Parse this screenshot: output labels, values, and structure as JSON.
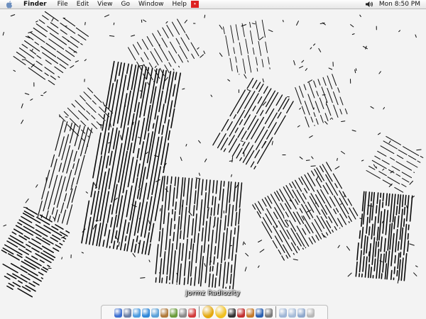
{
  "menubar": {
    "app_name": "Finder",
    "items": [
      "File",
      "Edit",
      "View",
      "Go",
      "Window",
      "Help"
    ],
    "clock": "Mon 8:50 PM"
  },
  "dock": {
    "hover_label": "Jormz Radiozity",
    "icons": [
      {
        "name": "finder-icon",
        "color": "#3d6fd1"
      },
      {
        "name": "mail-icon",
        "color": "#6a7fa6"
      },
      {
        "name": "ichat-icon",
        "color": "#4b9be0"
      },
      {
        "name": "safari-icon",
        "color": "#2f87d8"
      },
      {
        "name": "itunes-icon",
        "color": "#5aa0d8"
      },
      {
        "name": "address-book-icon",
        "color": "#b0793a"
      },
      {
        "name": "iphoto-icon",
        "color": "#6b9c3c"
      },
      {
        "name": "system-preferences-icon",
        "color": "#8a8a8a"
      },
      {
        "name": "ical-icon",
        "color": "#d23b3b"
      },
      {
        "name": "jormz-radiozity-icon",
        "color": "#e3a80f",
        "big": true
      },
      {
        "name": "z-app-icon",
        "color": "#f0c020",
        "big": true
      },
      {
        "name": "disc-icon",
        "color": "#333333"
      },
      {
        "name": "calendar-icon",
        "color": "#c23030"
      },
      {
        "name": "preview-icon",
        "color": "#c47a2c"
      },
      {
        "name": "quicktime-icon",
        "color": "#2a5fb0"
      },
      {
        "name": "music-icon",
        "color": "#7a7a7a"
      },
      {
        "name": "documents-folder-icon",
        "color": "#9fb6d6"
      },
      {
        "name": "downloads-folder-icon",
        "color": "#a7bcd8"
      },
      {
        "name": "applications-folder-icon",
        "color": "#8fa8cc"
      },
      {
        "name": "trash-icon",
        "color": "#b8b8b8"
      }
    ]
  }
}
